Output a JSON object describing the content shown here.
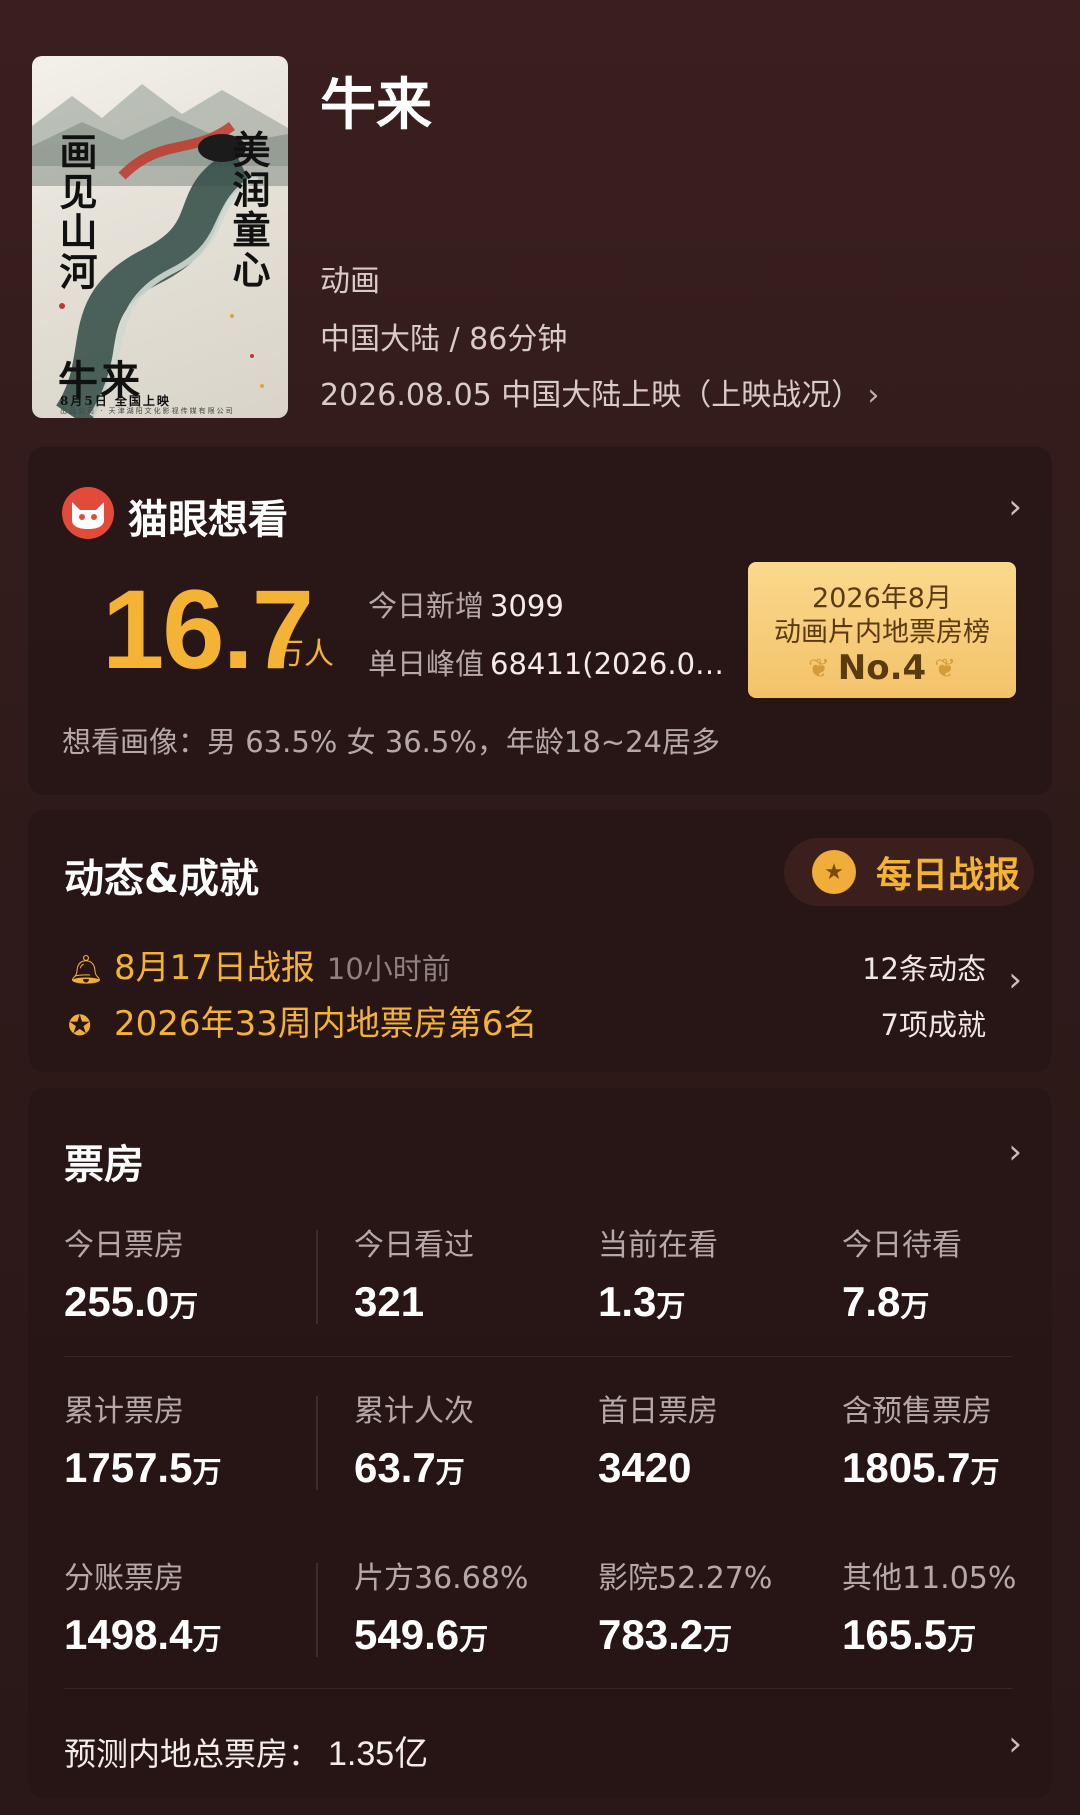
{
  "poster": {
    "calligraphy_left": "画见山河",
    "calligraphy_right": "美润童心",
    "title_mark": "牛来",
    "release_note": "8月5日 全国上映",
    "credits": "出品公司 · 天津湖阳文化影视传媒有限公司"
  },
  "movie": {
    "title": "牛来",
    "genre": "动画",
    "region_duration": "中国大陆 / 86分钟",
    "release": "2026.08.05 中国大陆上映（上映战况）"
  },
  "maoyan": {
    "title": "猫眼想看",
    "count": "16.7",
    "unit": "万人",
    "today_label": "今日新增",
    "today_value": "3099",
    "peak_label": "单日峰值",
    "peak_value": "68411(2026.0…",
    "rank_line1": "2026年8月",
    "rank_line2": "动画片内地票房榜",
    "rank_value": "No.4",
    "portrait": "想看画像：男 63.5%  女 36.5%，年龄18~24居多"
  },
  "dynamics": {
    "title": "动态&成就",
    "daily_button": "每日战报",
    "report": "8月17日战报",
    "report_ago": "10小时前",
    "achievement": "2026年33周内地票房第6名",
    "count_dynamics": "12条动态",
    "count_achievements": "7项成就"
  },
  "boxoffice": {
    "title": "票房",
    "rows": [
      [
        {
          "label": "今日票房",
          "value": "255.0",
          "unit": "万"
        },
        {
          "label": "今日看过",
          "value": "321",
          "unit": ""
        },
        {
          "label": "当前在看",
          "value": "1.3",
          "unit": "万"
        },
        {
          "label": "今日待看",
          "value": "7.8",
          "unit": "万"
        }
      ],
      [
        {
          "label": "累计票房",
          "value": "1757.5",
          "unit": "万"
        },
        {
          "label": "累计人次",
          "value": "63.7",
          "unit": "万"
        },
        {
          "label": "首日票房",
          "value": "3420",
          "unit": ""
        },
        {
          "label": "含预售票房",
          "value": "1805.7",
          "unit": "万"
        }
      ],
      [
        {
          "label": "分账票房",
          "value": "1498.4",
          "unit": "万"
        },
        {
          "label": "片方36.68%",
          "value": "549.6",
          "unit": "万"
        },
        {
          "label": "影院52.27%",
          "value": "783.2",
          "unit": "万"
        },
        {
          "label": "其他11.05%",
          "value": "165.5",
          "unit": "万"
        }
      ]
    ],
    "forecast_label": "预测内地总票房：",
    "forecast_value": "1.35亿"
  },
  "colors": {
    "accent": "#f5b336",
    "background": "#2f1a1a",
    "card": "#261414",
    "maoyan_red": "#e24b3b"
  }
}
